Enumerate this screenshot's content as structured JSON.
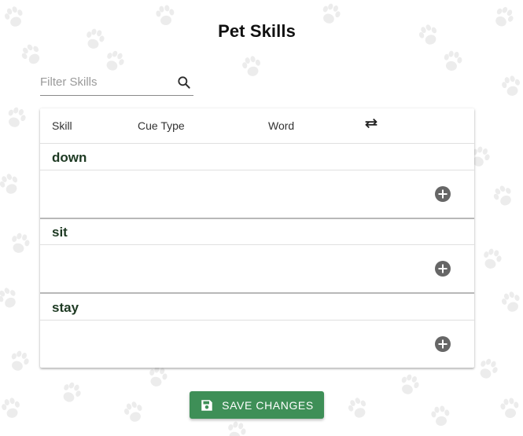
{
  "page": {
    "title": "Pet Skills"
  },
  "filter": {
    "placeholder": "Filter Skills",
    "value": "",
    "icon": "search-icon"
  },
  "table": {
    "headers": {
      "skill": "Skill",
      "cue_type": "Cue Type",
      "word": "Word",
      "swap_icon": "swap-icon"
    },
    "groups": [
      {
        "name": "down",
        "add_icon": "add-circle-icon"
      },
      {
        "name": "sit",
        "add_icon": "add-circle-icon"
      },
      {
        "name": "stay",
        "add_icon": "add-circle-icon"
      }
    ]
  },
  "actions": {
    "save_label": "SAVE CHANGES",
    "save_icon": "save-icon"
  },
  "colors": {
    "accent": "#3e8f57",
    "group_text": "#1e3a23",
    "icon_gray": "#666666",
    "paw_pattern": "#e9e9e9"
  }
}
